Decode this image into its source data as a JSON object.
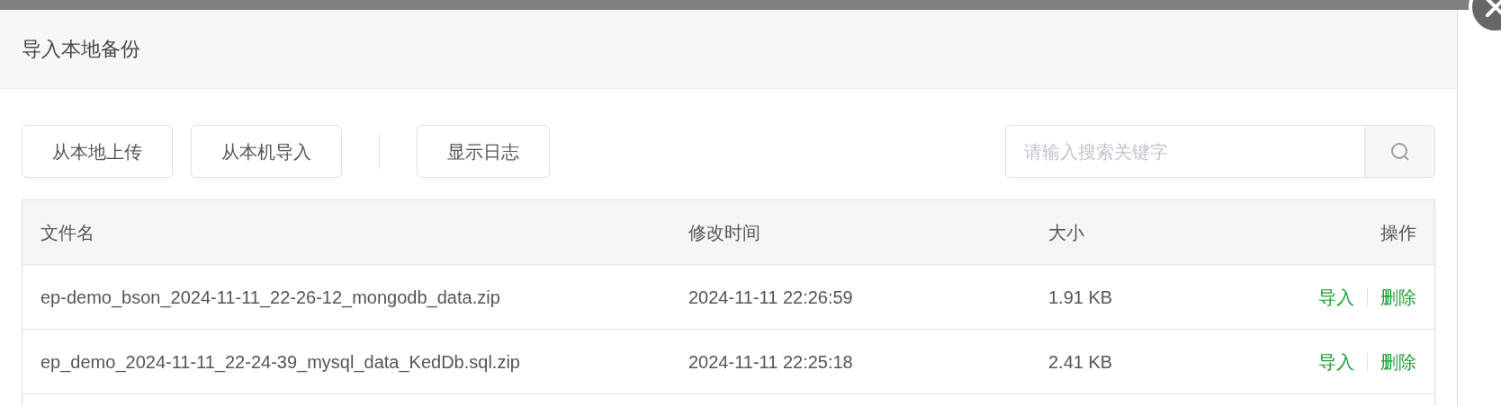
{
  "dialog": {
    "title": "导入本地备份"
  },
  "toolbar": {
    "buttons": [
      "从本地上传",
      "从本机导入"
    ],
    "log_button": "显示日志",
    "search": {
      "placeholder": "请输入搜索关键字"
    }
  },
  "table": {
    "columns": [
      "文件名",
      "修改时间",
      "大小",
      "操作"
    ],
    "rows": [
      {
        "name": "ep-demo_bson_2024-11-11_22-26-12_mongodb_data.zip",
        "modified": "2024-11-11 22:26:59",
        "size": "1.91 KB",
        "actions": [
          "导入",
          "删除"
        ]
      },
      {
        "name": "ep_demo_2024-11-11_22-24-39_mysql_data_KedDb.sql.zip",
        "modified": "2024-11-11 22:25:18",
        "size": "2.41 KB",
        "actions": [
          "导入",
          "删除"
        ]
      }
    ]
  }
}
